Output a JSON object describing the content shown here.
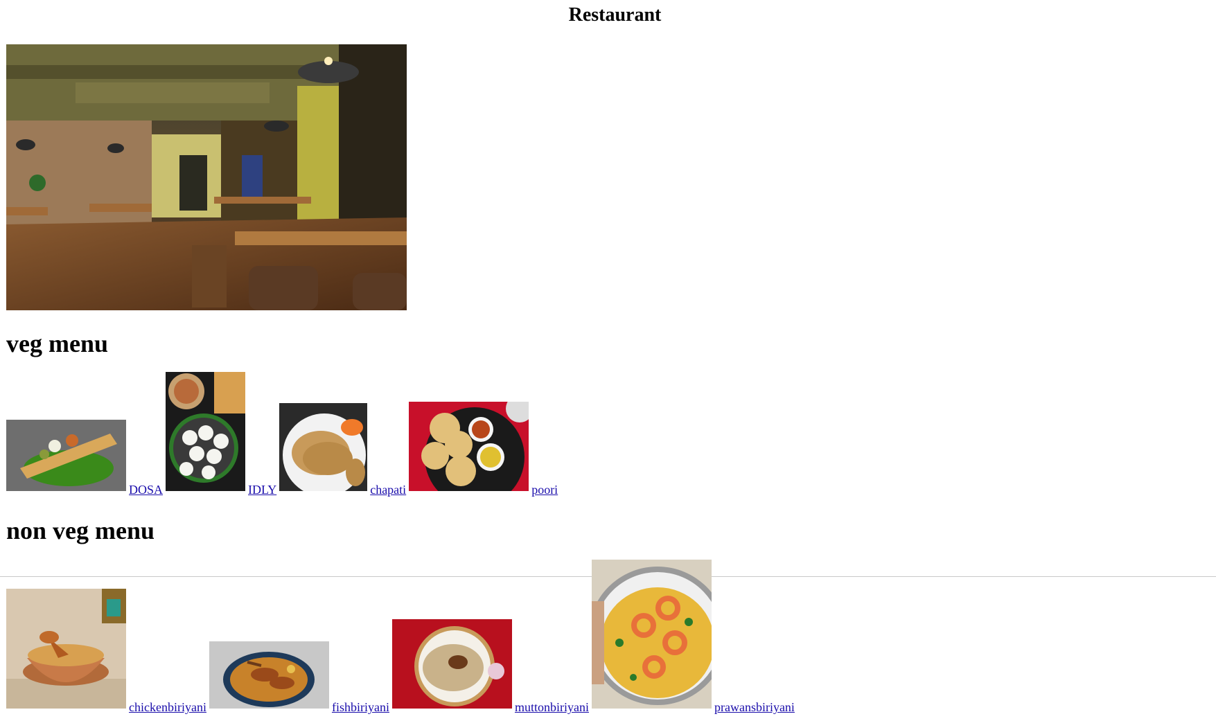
{
  "page": {
    "title": "Restaurant"
  },
  "veg_menu": {
    "heading": "veg menu",
    "items": [
      {
        "label": "DOSA"
      },
      {
        "label": "IDLY"
      },
      {
        "label": "chapati"
      },
      {
        "label": "poori"
      }
    ]
  },
  "nonveg_menu": {
    "heading": "non veg menu",
    "items": [
      {
        "label": "chickenbiriyani"
      },
      {
        "label": "fishbiriyani"
      },
      {
        "label": "muttonbiriyani"
      },
      {
        "label": "prawansbiriyani"
      }
    ]
  }
}
